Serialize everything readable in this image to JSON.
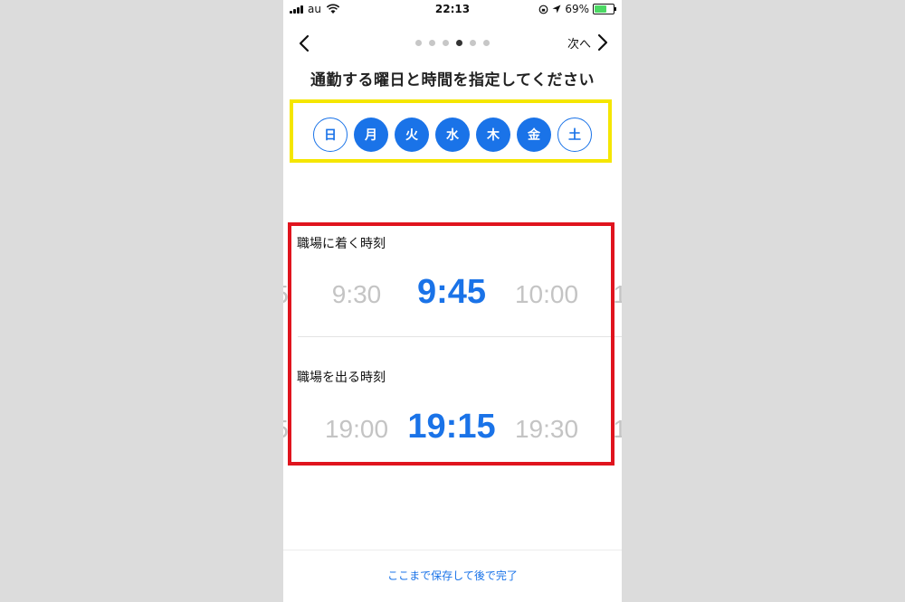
{
  "status_bar": {
    "carrier": "au",
    "time": "22:13",
    "battery_percent": "69%"
  },
  "nav": {
    "next_label": "次へ",
    "steps_total": 6,
    "current_step": 4
  },
  "title": "通勤する曜日と時間を指定してください",
  "days": [
    {
      "label": "日",
      "selected": false
    },
    {
      "label": "月",
      "selected": true
    },
    {
      "label": "火",
      "selected": true
    },
    {
      "label": "水",
      "selected": true
    },
    {
      "label": "木",
      "selected": true
    },
    {
      "label": "金",
      "selected": true
    },
    {
      "label": "土",
      "selected": false
    }
  ],
  "arrival": {
    "label": "職場に着く時刻",
    "edge_left": "5",
    "prev": "9:30",
    "selected": "9:45",
    "next": "10:00",
    "edge_right": "1"
  },
  "departure": {
    "label": "職場を出る時刻",
    "edge_left": "5",
    "prev": "19:00",
    "selected": "19:15",
    "next": "19:30",
    "edge_right": "1"
  },
  "footer": {
    "save_label": "ここまで保存して後で完了"
  },
  "colors": {
    "accent": "#1a73e8",
    "highlight_days": "#f5e600",
    "highlight_times": "#e0141e",
    "background": "#dcdcdc"
  }
}
